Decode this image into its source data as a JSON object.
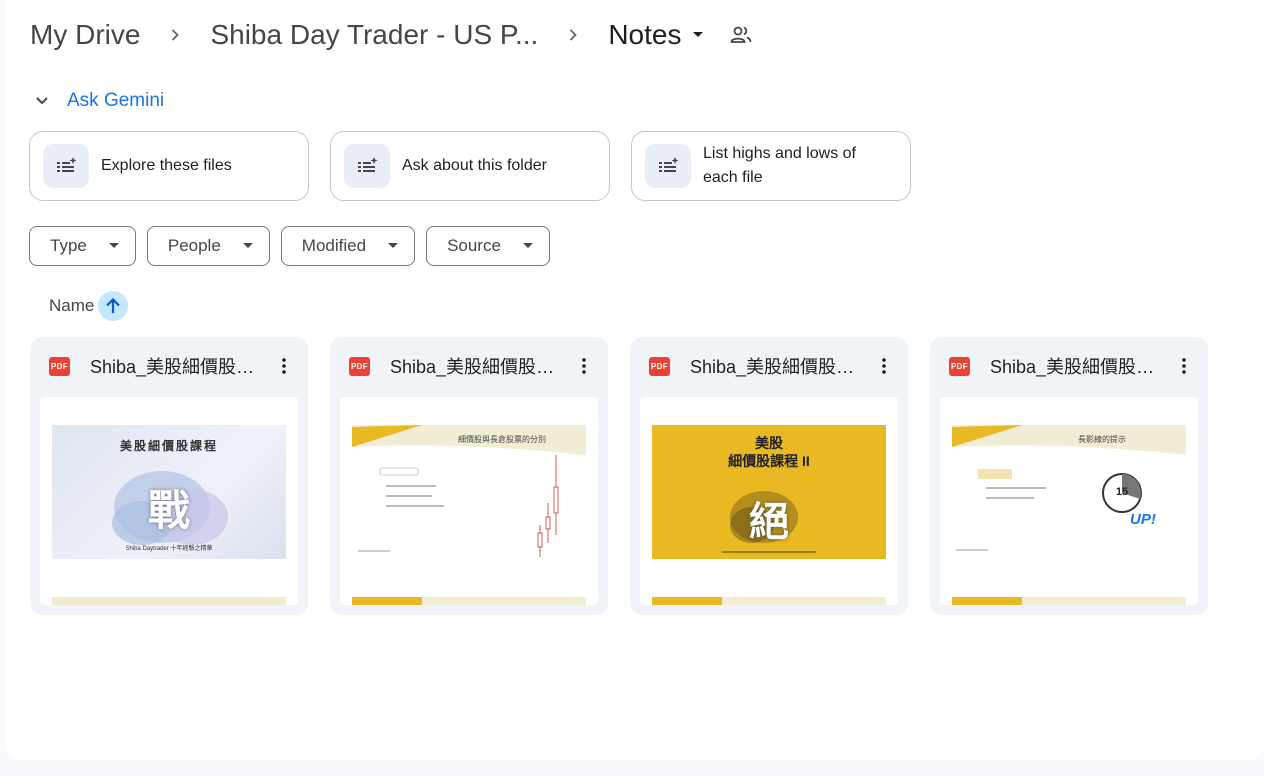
{
  "breadcrumb": {
    "items": [
      {
        "label": "My Drive"
      },
      {
        "label": "Shiba Day Trader - US P..."
      },
      {
        "label": "Notes"
      }
    ]
  },
  "gemini": {
    "title": "Ask Gemini",
    "suggestions": [
      {
        "label": "Explore these files"
      },
      {
        "label": "Ask about this folder"
      },
      {
        "label": "List highs and lows of each file"
      }
    ]
  },
  "filters": [
    {
      "label": "Type"
    },
    {
      "label": "People"
    },
    {
      "label": "Modified"
    },
    {
      "label": "Source"
    }
  ],
  "sort": {
    "label": "Name",
    "direction": "ascending"
  },
  "files": [
    {
      "name": "Shiba_美股細價股課...",
      "type": "PDF",
      "thumb": {
        "title": "美股細價股課程",
        "big_char": "戰",
        "subtitle": "Shiba Daytrader 十年經驗之精華"
      }
    },
    {
      "name": "Shiba_美股細價股課...",
      "type": "PDF",
      "thumb": {
        "title": "細價股與長倉股票的分別"
      }
    },
    {
      "name": "Shiba_美股細價股課...",
      "type": "PDF",
      "thumb": {
        "title": "美股",
        "title2": "細價股課程 II",
        "big_char": "絕"
      }
    },
    {
      "name": "Shiba_美股細價股課...",
      "type": "PDF",
      "thumb": {
        "title": "長影線的提示",
        "timer": "15",
        "badge": "UP!"
      }
    }
  ],
  "colors": {
    "accent": "#1a73e8",
    "sort_bg": "#c2e7ff",
    "pdf_red": "#ea4335",
    "card_bg": "#f0f4f9",
    "slide_yellow": "#e8b923"
  }
}
